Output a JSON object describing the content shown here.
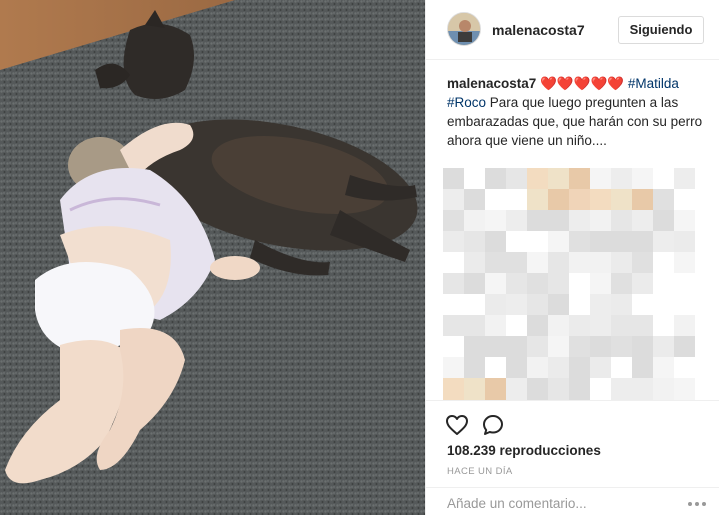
{
  "post": {
    "username": "malenacosta7",
    "follow_label": "Siguiendo"
  },
  "caption": {
    "username": "malenacosta7",
    "hearts": "❤️❤️❤️❤️❤️",
    "tag1": "#Matilda",
    "tag2": "#Roco",
    "text": "Para que luego pregunten a las embarazadas que, que harán con su perro ahora que viene un niño...."
  },
  "icons": {
    "like": "heart-outline-icon",
    "comment": "speech-bubble-icon",
    "more": "ellipsis-icon"
  },
  "stats": {
    "views": "108.239 reproducciones",
    "time": "HACE UN DÍA"
  },
  "comment": {
    "placeholder": "Añade un comentario..."
  },
  "colors": {
    "tag": "#003569",
    "border": "#efefef",
    "muted": "#999999",
    "text": "#262626"
  }
}
